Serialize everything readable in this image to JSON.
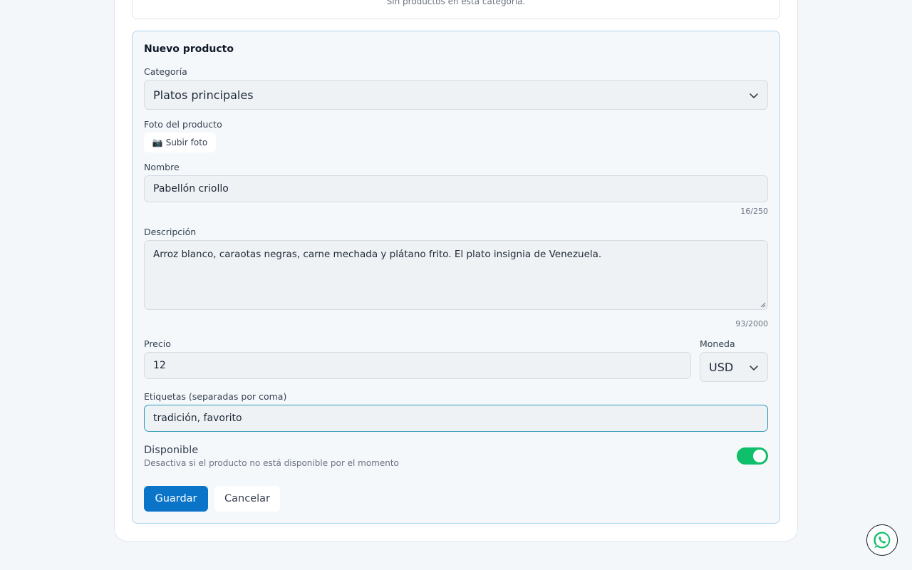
{
  "empty_category": {
    "text": "Sin productos en esta categoría."
  },
  "form": {
    "title": "Nuevo producto",
    "category": {
      "label": "Categoría",
      "value": "Platos principales",
      "icon": "chevron-down-icon"
    },
    "photo": {
      "label": "Foto del producto",
      "button_icon": "📷",
      "button_label": "Subir foto"
    },
    "name": {
      "label": "Nombre",
      "value": "Pabellón criollo",
      "counter": "16/250"
    },
    "description": {
      "label": "Descripción",
      "value": "Arroz blanco, caraotas negras, carne mechada y plátano frito. El plato insignia de Venezuela.",
      "counter": "93/2000"
    },
    "price": {
      "label": "Precio",
      "value": "12"
    },
    "currency": {
      "label": "Moneda",
      "value": "USD",
      "icon": "chevron-down-icon"
    },
    "tags": {
      "label": "Etiquetas (separadas por coma)",
      "value": "tradición, favorito"
    },
    "available": {
      "label": "Disponible",
      "hint": "Desactiva si el producto no está disponible por el momento",
      "enabled": true,
      "color": "#0fbf6a"
    },
    "save_label": "Guardar",
    "cancel_label": "Cancelar"
  },
  "whatsapp": {
    "icon": "whatsapp-icon"
  },
  "colors": {
    "primary": "#0a74c9",
    "focus_border": "#2f9ab7",
    "card_border": "#a9d6ee"
  }
}
